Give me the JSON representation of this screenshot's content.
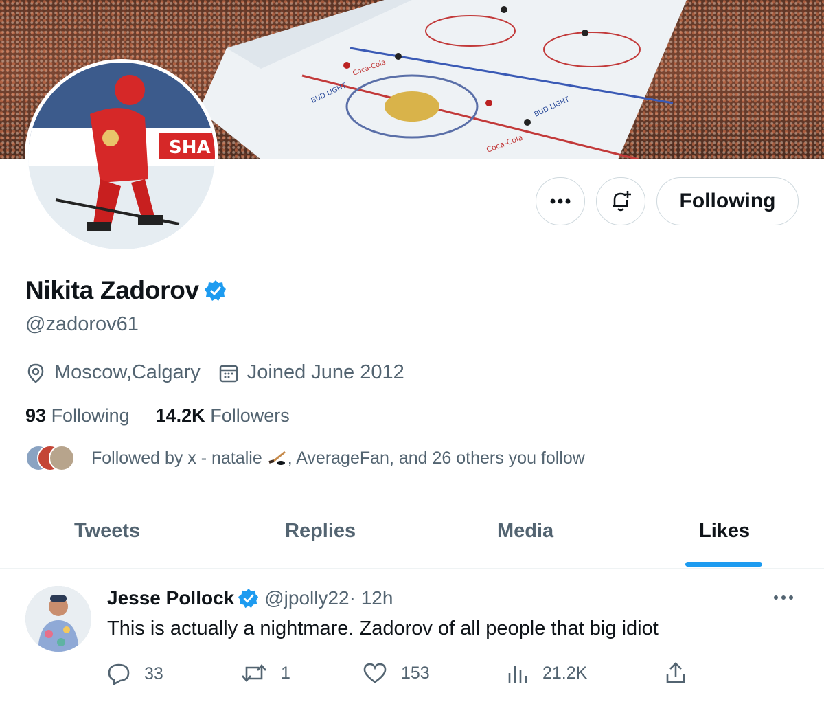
{
  "banner": {
    "alt_icon": "hockey-arena-banner"
  },
  "profile": {
    "name": "Nikita Zadorov",
    "handle": "@zadorov61",
    "location": "Moscow,Calgary",
    "joined": "Joined June 2012",
    "following_count": "93",
    "following_label": "Following",
    "followers_count": "14.2K",
    "followers_label": "Followers",
    "followed_by_prefix": "Followed by x - natalie ",
    "followed_by_suffix": ", AverageFan, and 26 others you follow",
    "verified_color": "#1d9bf0"
  },
  "actions": {
    "following_button": "Following"
  },
  "tabs": [
    {
      "label": "Tweets"
    },
    {
      "label": "Replies"
    },
    {
      "label": "Media"
    },
    {
      "label": "Likes"
    }
  ],
  "tweet": {
    "author_name": "Jesse Pollock",
    "author_handle": "@jpolly22",
    "time": " · 12h",
    "text": "This is actually a nightmare. Zadorov of all people that big idiot",
    "replies": "33",
    "retweets": "1",
    "likes": "153",
    "views": "21.2K"
  }
}
